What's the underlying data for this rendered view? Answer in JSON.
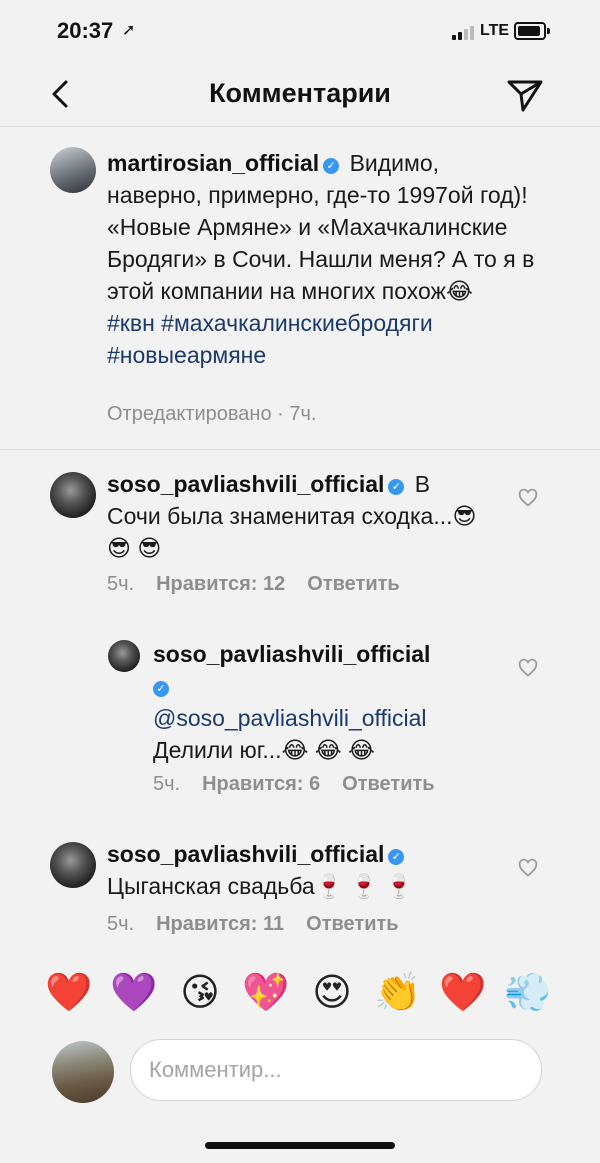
{
  "status": {
    "time": "20:37",
    "network": "LTE"
  },
  "header": {
    "title": "Комментарии"
  },
  "caption": {
    "username": "martirosian_official",
    "text_part1": "Видимо, наверно, примерно, где-то 1997ой год)! «Новые Армяне» и «Махачкалинские Бродяги» в Сочи. Нашли меня? А то я в этой компании на многих похож😂",
    "hashtags": [
      "#квн",
      "#махачкалинскиебродяги",
      "#новыеармяне"
    ],
    "meta": "Отредактировано · 7ч."
  },
  "comments": [
    {
      "username": "soso_pavliashvili_official",
      "text": "В Сочи была знаменитая сходка...😎 😎 😎",
      "time": "5ч.",
      "likes": "Нравится: 12",
      "reply": "Ответить"
    },
    {
      "username": "soso_pavliashvili_official",
      "mention": "@soso_pavliashvili_official",
      "text": "Делили юг...😂 😂 😂",
      "time": "5ч.",
      "likes": "Нравится: 6",
      "reply": "Ответить"
    },
    {
      "username": "soso_pavliashvili_official",
      "text": "Цыганская свадьба🍷 🍷 🍷",
      "time": "5ч.",
      "likes": "Нравится: 11",
      "reply": "Ответить"
    }
  ],
  "quick_emojis": [
    "❤️",
    "💜",
    "😘",
    "💖",
    "😍",
    "👏",
    "❤️",
    "💨"
  ],
  "input": {
    "placeholder": "Комментир..."
  },
  "colors": {
    "verified": "#3897f0",
    "hashtag": "#1b3a6a",
    "meta": "#8e8e8e"
  }
}
